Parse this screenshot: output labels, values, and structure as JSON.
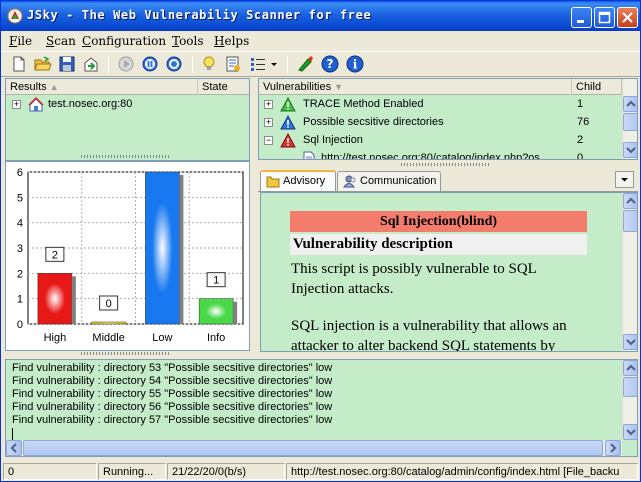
{
  "window": {
    "title": "JSky - The Web Vulnerabiliy Scanner for free"
  },
  "menu": [
    "File",
    "Scan",
    "Configuration",
    "Tools",
    "Helps"
  ],
  "results": {
    "columns": [
      "Results",
      "State"
    ],
    "rows": [
      {
        "label": "test.nosec.org:80",
        "state": ""
      }
    ]
  },
  "vulns": {
    "columns": [
      "Vulnerabilities",
      "Child"
    ],
    "rows": [
      {
        "expander": "+",
        "icon": "warning-green-icon",
        "label": "TRACE Method Enabled",
        "child": "1"
      },
      {
        "expander": "+",
        "icon": "info-blue-icon",
        "label": "Possible secsitive directories",
        "child": "76"
      },
      {
        "expander": "−",
        "icon": "danger-red-icon",
        "label": "Sql Injection",
        "child": "2"
      },
      {
        "expander": "",
        "icon": "page-icon",
        "label": "http://test.nosec.org:80/catalog/index.php?os",
        "child": "0"
      }
    ]
  },
  "tabs": [
    {
      "label": "Advisory",
      "active": true
    },
    {
      "label": "Communication",
      "active": false
    }
  ],
  "advisory": {
    "title": "Sql Injection(blind)",
    "subtitle": "Vulnerability description",
    "text1": "This script is possibly vulnerable to SQL Injection attacks.",
    "text2": "SQL injection is a vulnerability that allows an attacker to alter backend SQL statements by"
  },
  "log": [
    "Find vulnerability : directory 53 \"Possible secsitive directories\" low",
    "Find vulnerability : directory 54 \"Possible secsitive directories\" low",
    "Find vulnerability : directory 55 \"Possible secsitive directories\" low",
    "Find vulnerability : directory 56 \"Possible secsitive directories\" low",
    "Find vulnerability : directory 57 \"Possible secsitive directories\" low"
  ],
  "status": {
    "count": "0",
    "state": "Running...",
    "rate": "21/22/20/0(b/s)",
    "url": "http://test.nosec.org:80/catalog/admin/config/index.html [File_backu"
  },
  "chart_data": {
    "type": "bar",
    "categories": [
      "High",
      "Middle",
      "Low",
      "Info"
    ],
    "values": [
      2,
      0,
      6,
      1
    ],
    "colors": [
      "#e81818",
      "#e8d818",
      "#1878f0",
      "#48d848"
    ],
    "ylim": [
      0,
      6
    ],
    "yticks": [
      "0",
      "1",
      "2",
      "3",
      "4",
      "5",
      "6"
    ],
    "data_labels": [
      "2",
      "0",
      "",
      "1"
    ],
    "grid": true
  }
}
